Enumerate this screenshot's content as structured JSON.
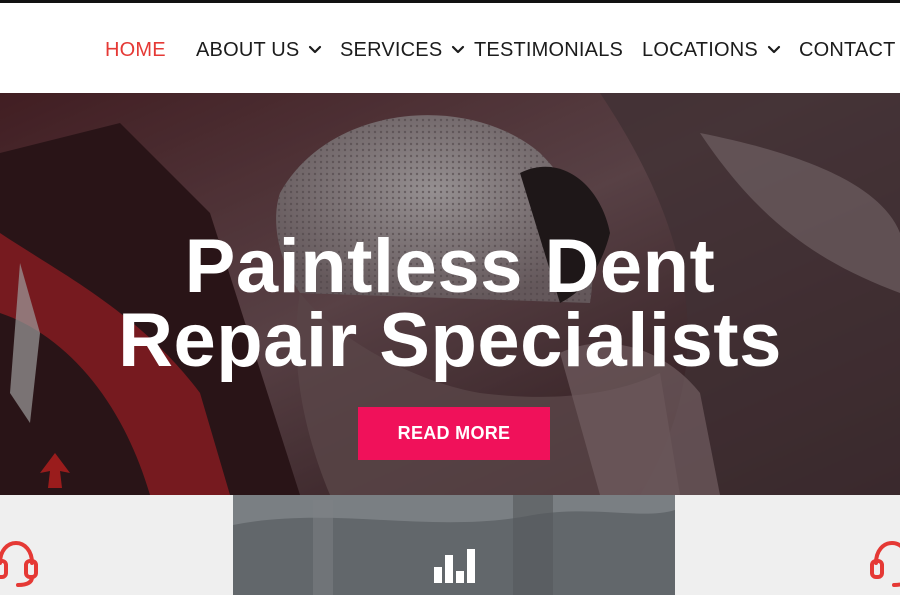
{
  "nav": {
    "items": [
      {
        "label": "HOME",
        "active": true,
        "has_dropdown": false
      },
      {
        "label": "ABOUT US",
        "active": false,
        "has_dropdown": true
      },
      {
        "label": "SERVICES",
        "active": false,
        "has_dropdown": true
      },
      {
        "label": "TESTIMONIALS",
        "active": false,
        "has_dropdown": false
      },
      {
        "label": "LOCATIONS",
        "active": false,
        "has_dropdown": true
      },
      {
        "label": "CONTACT US",
        "active": false,
        "has_dropdown": false
      }
    ],
    "active_color": "#e53935",
    "text_color": "#1c1c1c"
  },
  "hero": {
    "title_line1": "Paintless Dent",
    "title_line2": "Repair Specialists",
    "cta_label": "READ MORE",
    "cta_color": "#f0115a"
  },
  "features": {
    "left_icon": "headset-icon",
    "middle_icon": "bar-chart-icon",
    "right_icon": "headset-icon",
    "icon_color": "#e53935"
  }
}
